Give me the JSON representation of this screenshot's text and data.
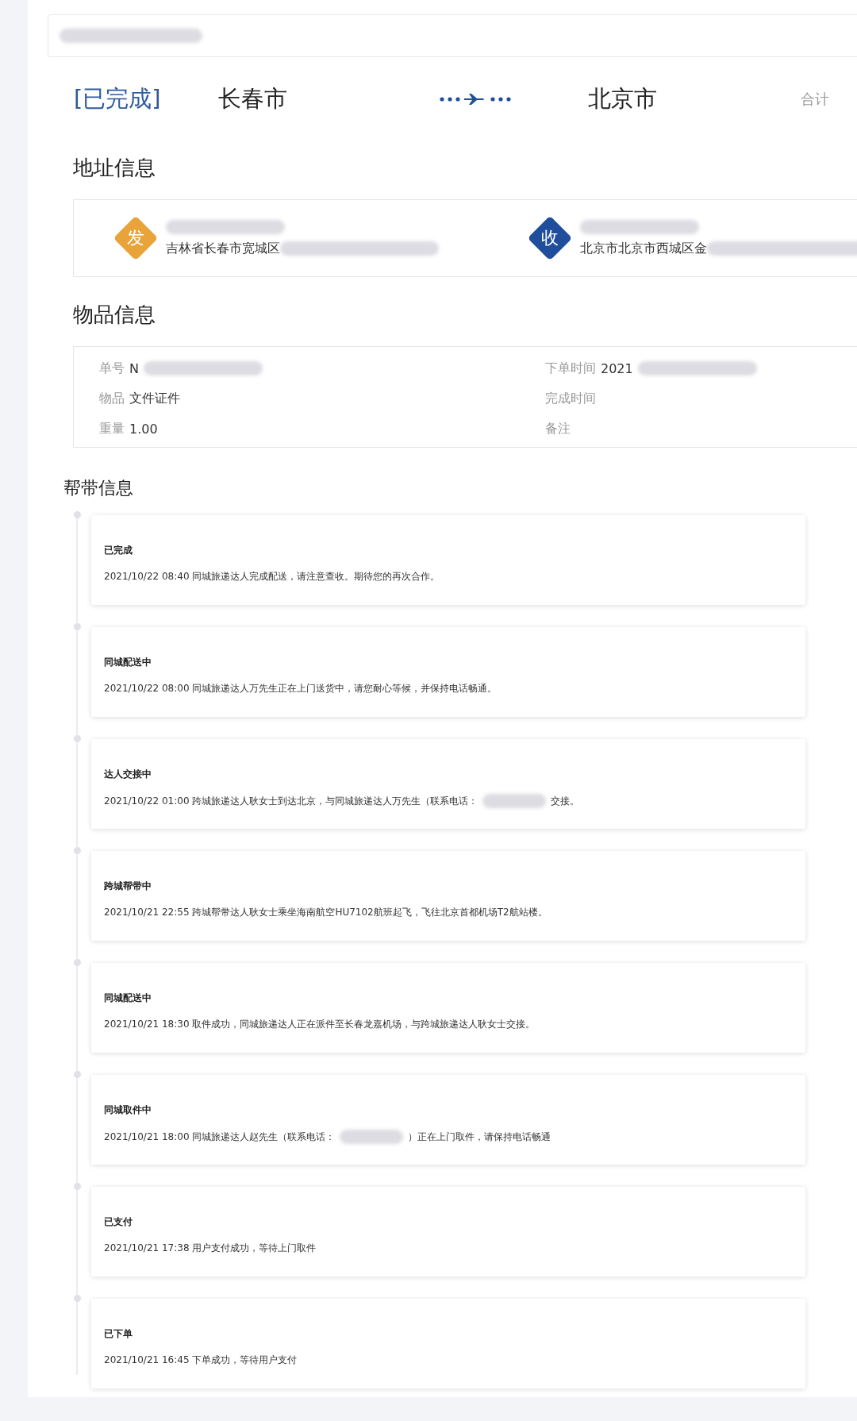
{
  "route": {
    "status": "[已完成]",
    "origin": "长春市",
    "destination": "北京市",
    "total_label": "合计"
  },
  "address_section": {
    "title": "地址信息",
    "sender": {
      "badge": "发",
      "address": "吉林省长春市宽城区"
    },
    "receiver": {
      "badge": "收",
      "address": "北京市北京市西城区金"
    }
  },
  "item_section": {
    "title": "物品信息",
    "left": [
      {
        "label": "单号",
        "value": "N",
        "redacted": true
      },
      {
        "label": "物品",
        "value": "文件证件",
        "redacted": false
      },
      {
        "label": "重量",
        "value": "1.00",
        "redacted": false
      }
    ],
    "right": [
      {
        "label": "下单时间",
        "value": "2021",
        "redacted": true
      },
      {
        "label": "完成时间",
        "redacted": false
      },
      {
        "label": "备注",
        "redacted": false
      }
    ]
  },
  "timeline": {
    "title": "帮带信息",
    "events": [
      {
        "title": "已完成",
        "parts": [
          "2021/10/22 08:40 同城旅递达人完成配送，请注意查收。期待您的再次合作。"
        ]
      },
      {
        "title": "同城配送中",
        "parts": [
          "2021/10/22 08:00 同城旅递达人万先生正在上门送货中，请您耐心等候，并保持电话畅通。"
        ]
      },
      {
        "title": "达人交接中",
        "parts": [
          "2021/10/22 01:00 跨城旅递达人耿女士到达北京，与同城旅递达人万先生（联系电话：",
          "交接。"
        ]
      },
      {
        "title": "跨城帮带中",
        "parts": [
          "2021/10/21 22:55 跨城帮带达人耿女士乘坐海南航空HU7102航班起飞，飞往北京首都机场T2航站楼。"
        ]
      },
      {
        "title": "同城配送中",
        "parts": [
          "2021/10/21 18:30 取件成功，同城旅递达人正在派件至长春龙嘉机场，与跨城旅递达人耿女士交接。"
        ]
      },
      {
        "title": "同城取件中",
        "parts": [
          "2021/10/21 18:00 同城旅递达人赵先生（联系电话：",
          "）正在上门取件，请保持电话畅通"
        ]
      },
      {
        "title": "已支付",
        "parts": [
          "2021/10/21 17:38 用户支付成功，等待上门取件"
        ]
      },
      {
        "title": "已下单",
        "parts": [
          "2021/10/21 16:45 下单成功，等待用户支付"
        ]
      }
    ]
  }
}
